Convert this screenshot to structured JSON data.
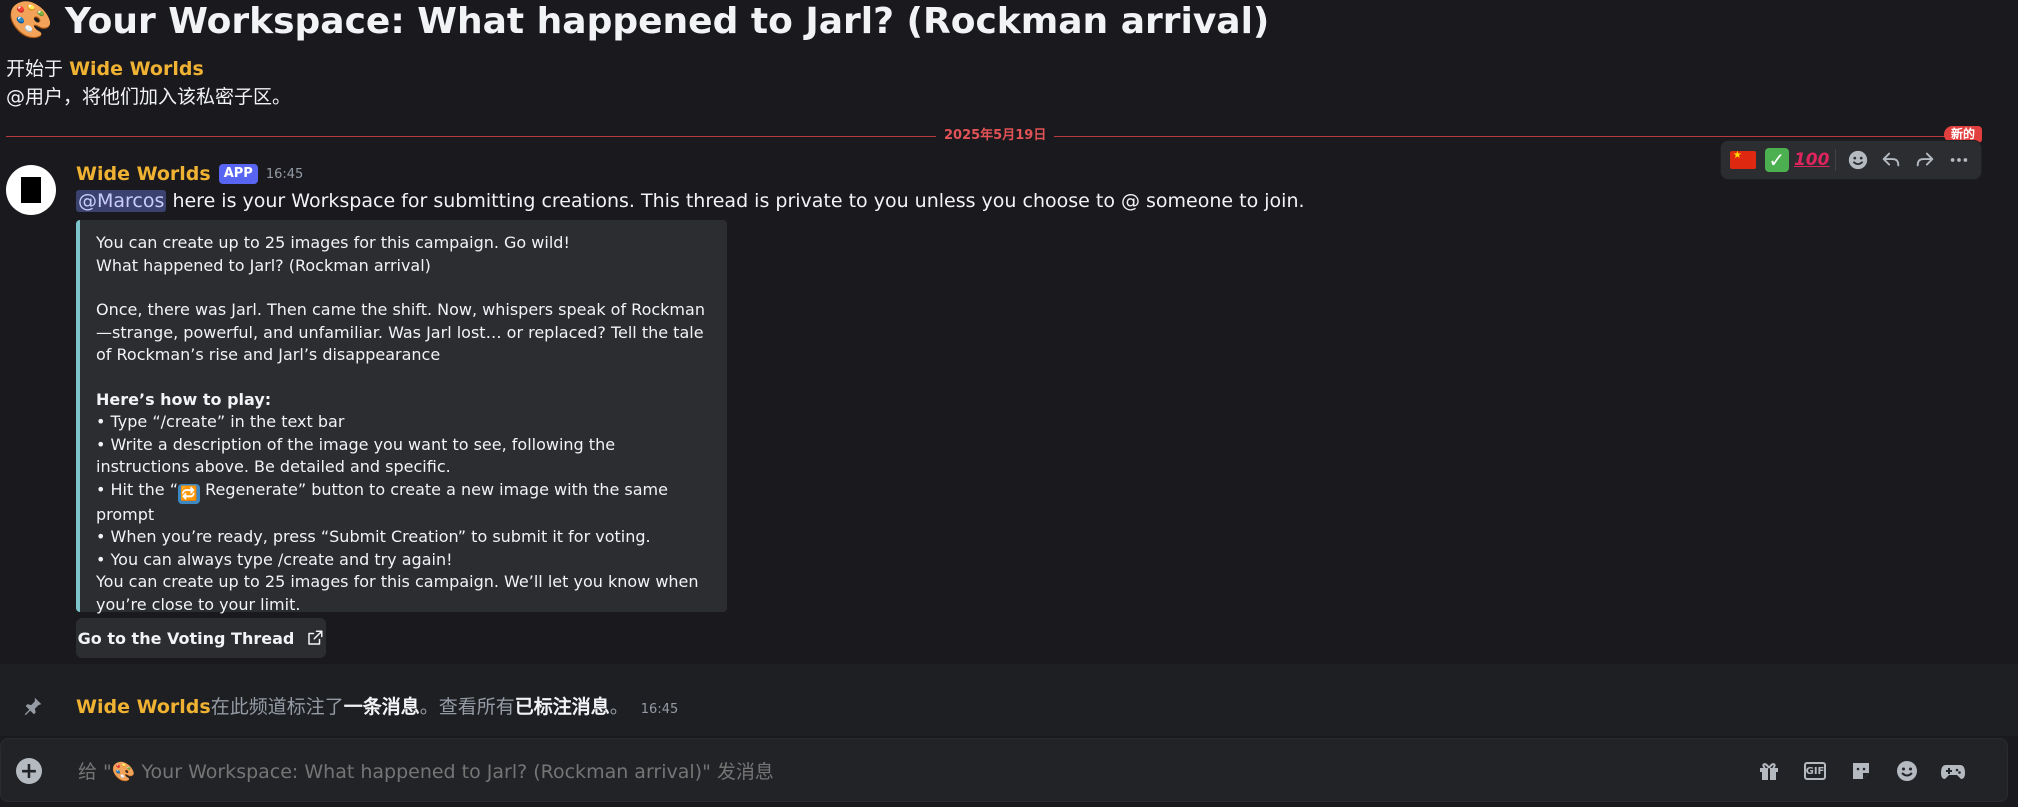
{
  "header": {
    "title_emoji": "🎨",
    "title": "Your Workspace: What happened to Jarl? (Rockman arrival)",
    "started_prefix": "开始于",
    "started_by": "Wide Worlds",
    "mention_tip": "@用户，将他们加入该私密子区。"
  },
  "divider": {
    "date": "2025年5月19日",
    "new_label": "新的"
  },
  "toolbar": {
    "reactions": [
      "china-flag",
      "check-mark",
      "hundred-points"
    ],
    "actions": [
      "add-reaction",
      "reply",
      "forward",
      "more"
    ]
  },
  "message": {
    "author": "Wide Worlds",
    "badge": "APP",
    "time": "16:45",
    "mention": "@Marcos",
    "text": " here is your Workspace for submitting creations. This thread is private to you unless you choose to @ someone to join.",
    "embed": {
      "line1": "You can create up to 25 images for this campaign. Go wild!",
      "line2": "What happened to Jarl? (Rockman arrival)",
      "para": "Once, there was Jarl. Then came the shift. Now, whispers speak of Rockman—strange, powerful, and unfamiliar. Was Jarl lost… or replaced? Tell the tale of Rockman’s rise and Jarl’s disappearance",
      "howto": "Here’s how to play:",
      "b1": "• Type “/create” in the text bar",
      "b2": "• Write a description of the image you want to see, following the instructions above. Be detailed and specific.",
      "b3_pre": "• Hit the “",
      "b3_emoji": "🔁",
      "b3_post": " Regenerate” button to create a new image with the same prompt",
      "b4": "• When you’re ready, press “Submit Creation” to submit it for voting.",
      "b5": "• You can always type /create and try again!",
      "footer": "You can create up to 25 images for this campaign. We’ll let you know when you’re close to your limit."
    },
    "button": "Go to the Voting Thread"
  },
  "pin_notice": {
    "author": "Wide Worlds",
    "text1": "在此频道标注了",
    "link1": "一条消息",
    "text2": "。查看所有",
    "link2": "已标注消息",
    "text3": "。",
    "time": "16:45"
  },
  "composer": {
    "placeholder": "给 \"🎨 Your Workspace: What happened to Jarl? (Rockman arrival)\" 发消息",
    "icons": [
      "gift-icon",
      "gif-icon",
      "sticker-icon",
      "emoji-icon",
      "apps-icon"
    ]
  }
}
